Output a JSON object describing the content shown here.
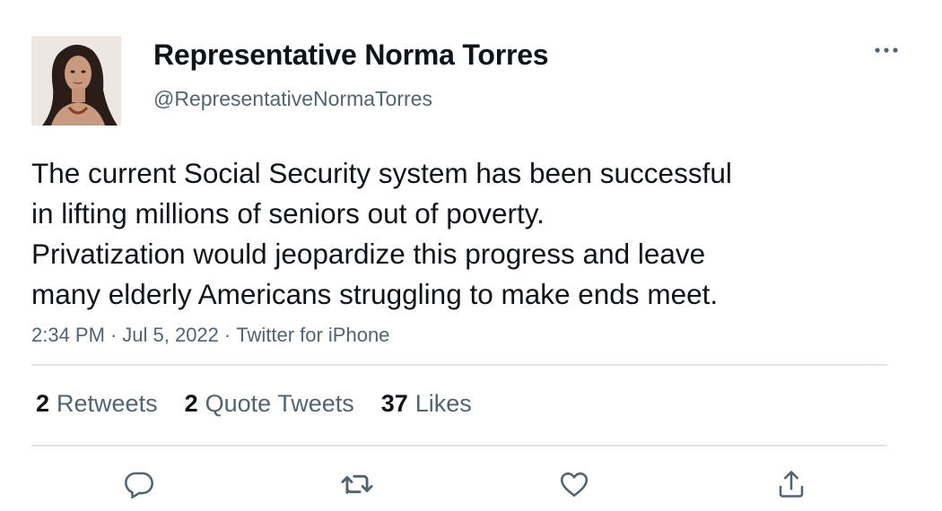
{
  "profile": {
    "display_name": "Representative Norma Torres",
    "handle": "@RepresentativeNormaTorres"
  },
  "tweet": {
    "lines": [
      "The current Social Security system has been successful",
      "in lifting millions of seniors out of poverty.",
      "Privatization would jeopardize this progress and leave",
      "many elderly Americans struggling to make ends meet."
    ],
    "time": "2:34 PM",
    "date": "Jul 5, 2022",
    "source": "Twitter for iPhone",
    "separator": "·"
  },
  "stats": {
    "retweets": {
      "count": "2",
      "label": "Retweets"
    },
    "quote_tweets": {
      "count": "2",
      "label": "Quote Tweets"
    },
    "likes": {
      "count": "37",
      "label": "Likes"
    }
  },
  "actions": {
    "reply": "reply-icon",
    "retweet": "retweet-icon",
    "like": "heart-icon",
    "share": "share-icon",
    "more": "more-icon"
  },
  "colors": {
    "text_primary": "#0f1419",
    "text_secondary": "#536471",
    "divider": "#e1e4e6"
  }
}
